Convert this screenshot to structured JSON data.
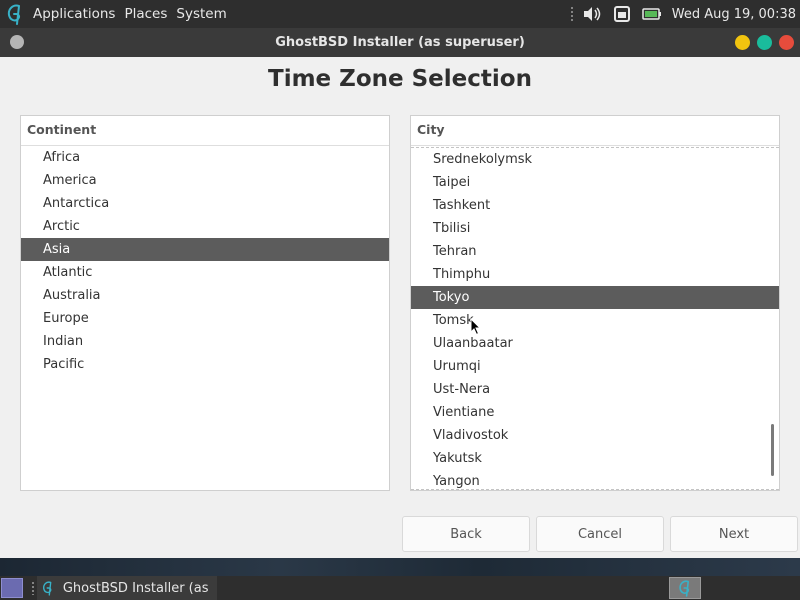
{
  "top_panel": {
    "menus": [
      "Applications",
      "Places",
      "System"
    ],
    "clock": "Wed Aug 19, 00:38"
  },
  "window": {
    "title": "GhostBSD Installer (as superuser)"
  },
  "page": {
    "title": "Time Zone Selection"
  },
  "continent": {
    "header": "Continent",
    "items": [
      "Africa",
      "America",
      "Antarctica",
      "Arctic",
      "Asia",
      "Atlantic",
      "Australia",
      "Europe",
      "Indian",
      "Pacific"
    ],
    "selected": "Asia"
  },
  "city": {
    "header": "City",
    "items": [
      "Srednekolymsk",
      "Taipei",
      "Tashkent",
      "Tbilisi",
      "Tehran",
      "Thimphu",
      "Tokyo",
      "Tomsk",
      "Ulaanbaatar",
      "Urumqi",
      "Ust-Nera",
      "Vientiane",
      "Vladivostok",
      "Yakutsk",
      "Yangon"
    ],
    "selected": "Tokyo"
  },
  "buttons": {
    "back": "Back",
    "cancel": "Cancel",
    "next": "Next"
  },
  "taskbar": {
    "task_label": "GhostBSD Installer (as s..."
  },
  "colors": {
    "selection": "#5c5c5c",
    "close": "#e74c3c",
    "minimize": "#f1c40f",
    "maximize": "#1abc9c",
    "logo": "#38b2c8"
  },
  "icons": {
    "logo": "ghostbsd-logo-icon",
    "volume": "speaker-icon",
    "network": "network-icon",
    "battery": "battery-icon"
  }
}
